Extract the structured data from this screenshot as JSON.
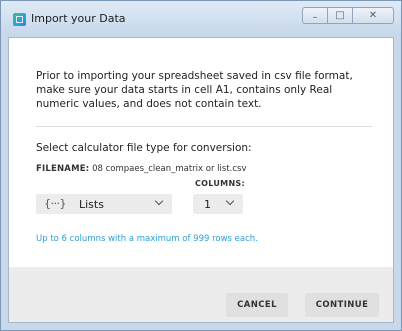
{
  "window": {
    "title": "Import your Data",
    "controls": {
      "minimize_glyph": "–",
      "maximize_glyph": "□",
      "close_glyph": "✕"
    }
  },
  "content": {
    "intro": "Prior to importing your spreadsheet saved in csv file format, make sure your data starts in cell A1, contains only Real numeric values, and does not contain text.",
    "select_heading": "Select calculator file type for conversion:",
    "filename_label": "FILENAME:",
    "filename_value": "08 compaes_clean_matrix or list.csv",
    "columns_label": "COLUMNS:",
    "file_type": {
      "icon": "braces-icon",
      "icon_glyph": "{···}",
      "selected": "Lists"
    },
    "columns": {
      "selected": "1"
    },
    "hint": "Up to 6 columns with a maximum of 999 rows each."
  },
  "footer": {
    "cancel_label": "CANCEL",
    "continue_label": "CONTINUE"
  },
  "colors": {
    "hint": "#2e9fd6",
    "footer": "#ececec",
    "button": "#e0e0e0"
  }
}
